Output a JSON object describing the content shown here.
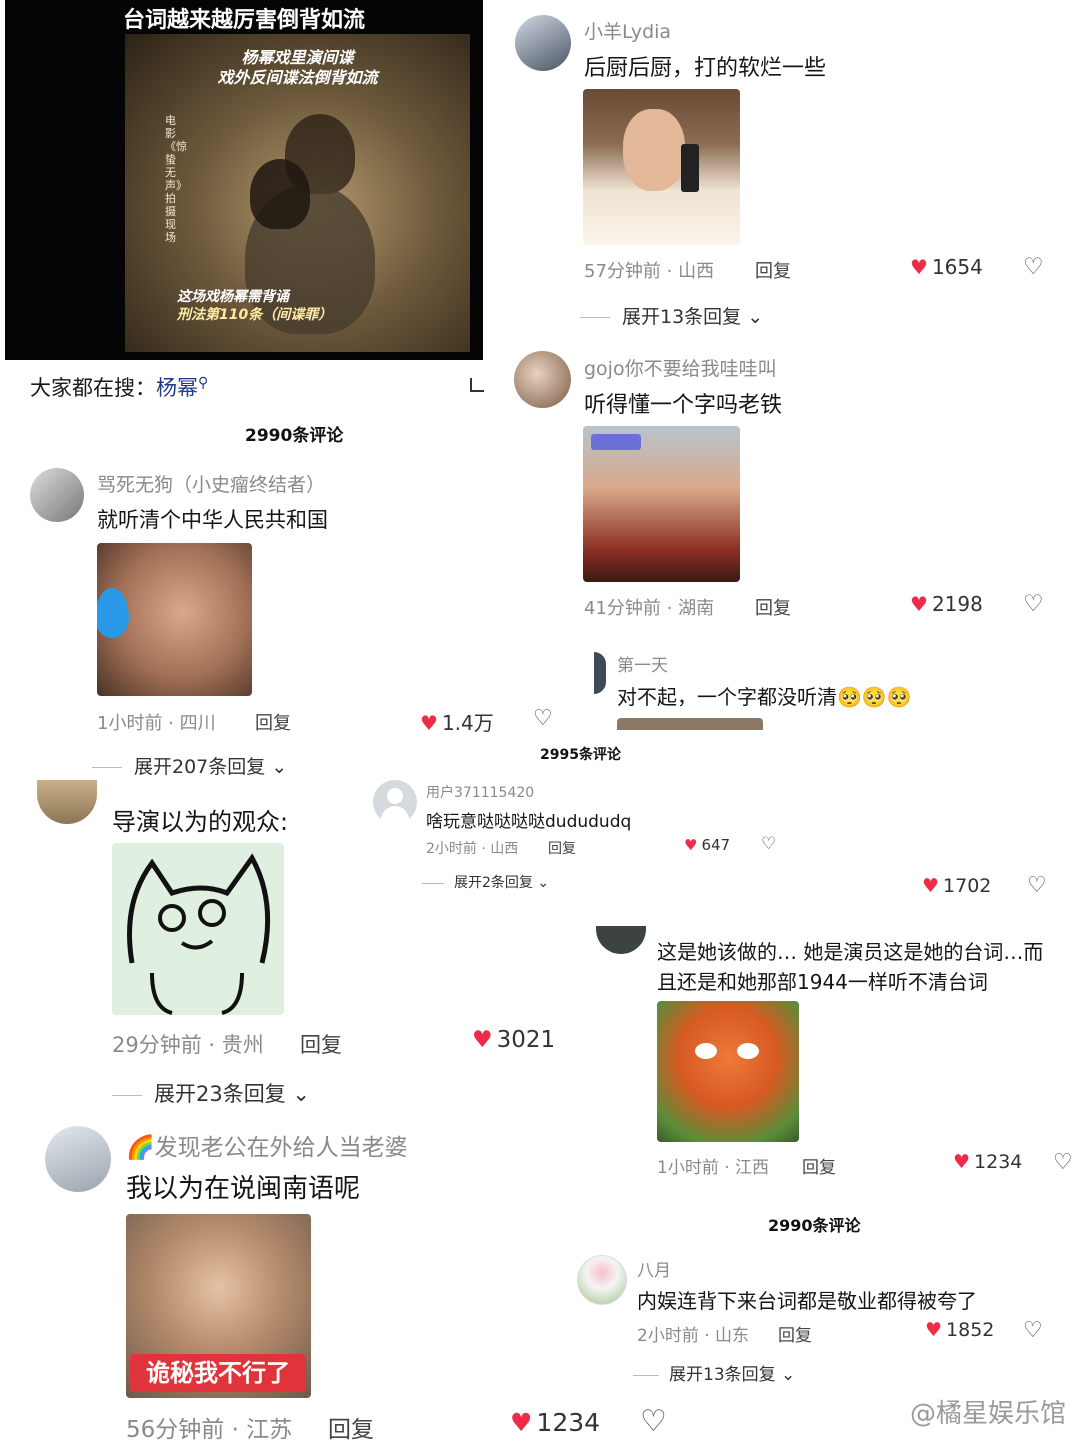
{
  "video": {
    "title": "台词越来越厉害倒背如流",
    "sub1": "杨幂戏里演间谍",
    "sub2": "戏外反间谍法倒背如流",
    "vertical_text": "电影《惊蛰无声》拍摄现场",
    "cap1": "这场戏杨幂需背诵",
    "cap2": "刑法第110条（间谍罪）"
  },
  "search": {
    "label": "大家都在搜：",
    "keyword": "杨幂"
  },
  "count_a": "2990条评论",
  "count_b": "2995条评论",
  "count_c": "2990条评论",
  "comments": {
    "c1": {
      "user": "骂死无狗（小史瘤终结者）",
      "text": "就听清个中华人民共和国",
      "time": "1小时前 · 四川",
      "reply": "回复",
      "likes": "1.4万",
      "expand": "展开207条回复"
    },
    "c2": {
      "user": "",
      "text": "导演以为的观众:",
      "time": "29分钟前 · 贵州",
      "reply": "回复",
      "likes": "3021",
      "expand": "展开23条回复"
    },
    "c3": {
      "user": "🌈发现老公在外给人当老婆",
      "text": "我以为在说闽南语呢",
      "time": "56分钟前 · 江苏",
      "reply": "回复",
      "likes": "1234",
      "sticker_text": "诡秘我不行了"
    },
    "c4": {
      "user": "小羊Lydia",
      "text": "后厨后厨，打的软烂一些",
      "time": "57分钟前 · 山西",
      "reply": "回复",
      "likes": "1654",
      "expand": "展开13条回复"
    },
    "c5": {
      "user": "gojo你不要给我哇哇叫",
      "text": "听得懂一个字吗老铁",
      "time": "41分钟前 · 湖南",
      "reply": "回复",
      "likes": "2198"
    },
    "c6": {
      "user": "第一天",
      "text": "对不起，一个字都没听清🥺🥺🥺"
    },
    "c7": {
      "user": "用户371115420",
      "text": "啥玩意哒哒哒哒dudududq",
      "time": "2小时前 · 山西",
      "reply": "回复",
      "likes": "647",
      "expand": "展开2条回复"
    },
    "c8": {
      "likes": "1702"
    },
    "c9": {
      "text1": "这是她该做的… 她是演员这是她的台词…而",
      "text2": "且还是和她那部1944一样听不清台词",
      "time": "1小时前 · 江西",
      "reply": "回复",
      "likes": "1234"
    },
    "c10": {
      "user": "八月",
      "text": "内娱连背下来台词都是敬业都得被夸了",
      "time": "2小时前 · 山东",
      "reply": "回复",
      "likes": "1852",
      "expand": "展开13条回复"
    }
  },
  "watermark": "@橘星娱乐馆",
  "icons": {
    "heart": "heart-icon",
    "dislike": "dislike-icon",
    "search": "search-icon",
    "chevron": "chevron-down-icon"
  },
  "colors": {
    "heart": "#ee2c4a",
    "meta": "#8a8a8a"
  }
}
